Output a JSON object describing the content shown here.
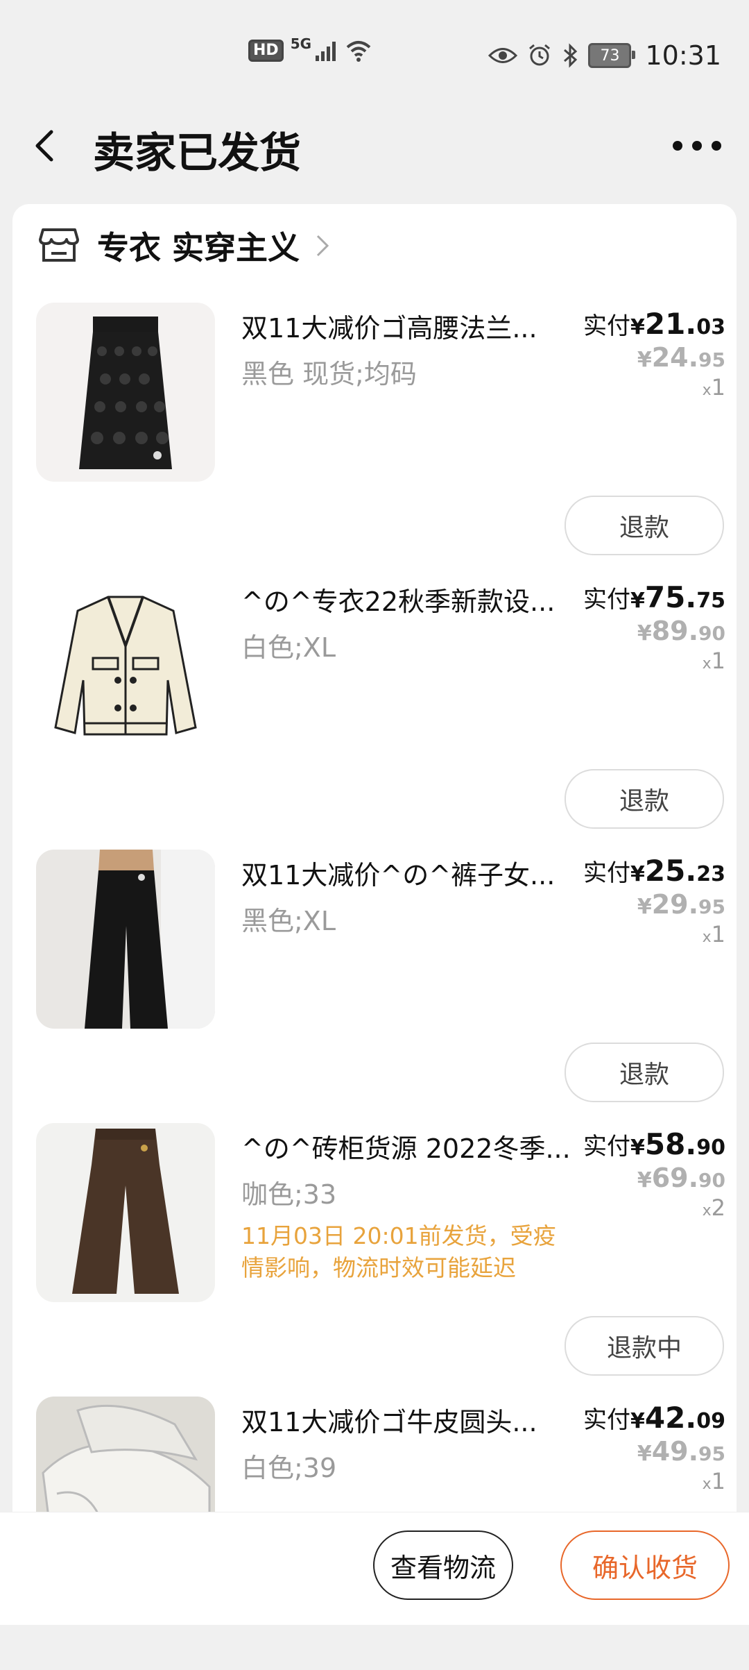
{
  "status_bar": {
    "hd": "HD",
    "network": "5G",
    "battery": "73",
    "time": "10:31"
  },
  "header": {
    "title": "卖家已发货"
  },
  "shop": {
    "name": "专衣 实穿主义"
  },
  "items": [
    {
      "name": "双11大减价ゴ高腰法兰...",
      "sku": "黑色 现货;均码",
      "paid_label": "实付",
      "currency": "¥",
      "paid_int": "21.",
      "paid_dec": "03",
      "orig_int": "24.",
      "orig_dec": "95",
      "qty_prefix": "x",
      "qty": "1",
      "notice": "",
      "action": "退款"
    },
    {
      "name": "^の^专衣22秋季新款设...",
      "sku": "白色;XL",
      "paid_label": "实付",
      "currency": "¥",
      "paid_int": "75.",
      "paid_dec": "75",
      "orig_int": "89.",
      "orig_dec": "90",
      "qty_prefix": "x",
      "qty": "1",
      "notice": "",
      "action": "退款"
    },
    {
      "name": "双11大减价^の^裤子女...",
      "sku": "黑色;XL",
      "paid_label": "实付",
      "currency": "¥",
      "paid_int": "25.",
      "paid_dec": "23",
      "orig_int": "29.",
      "orig_dec": "95",
      "qty_prefix": "x",
      "qty": "1",
      "notice": "",
      "action": "退款"
    },
    {
      "name": "^の^砖柜货源 2022冬季...",
      "sku": "咖色;33",
      "paid_label": "实付",
      "currency": "¥",
      "paid_int": "58.",
      "paid_dec": "90",
      "orig_int": "69.",
      "orig_dec": "90",
      "qty_prefix": "x",
      "qty": "2",
      "notice": "11月03日 20:01前发货，受疫情影响，物流时效可能延迟",
      "action": "退款中"
    },
    {
      "name": "双11大减价ゴ牛皮圆头...",
      "sku": "白色;39",
      "paid_label": "实付",
      "currency": "¥",
      "paid_int": "42.",
      "paid_dec": "09",
      "orig_int": "49.",
      "orig_dec": "95",
      "qty_prefix": "x",
      "qty": "1",
      "notice": "",
      "action": ""
    }
  ],
  "bottom_bar": {
    "logistics_label": "查看物流",
    "confirm_label": "确认收货"
  },
  "colors": {
    "accent": "#e8672a",
    "notice": "#e8a33c",
    "muted": "#9a9a9a"
  }
}
